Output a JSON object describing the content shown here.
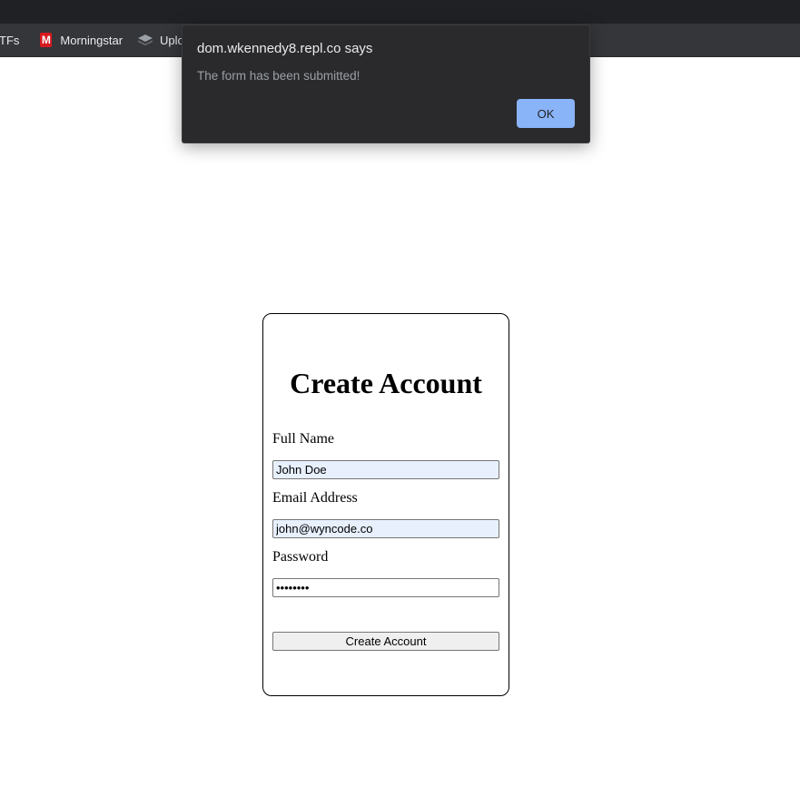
{
  "browser": {
    "bookmarks": [
      {
        "label": "TFs",
        "icon": "none"
      },
      {
        "label": "Morningstar",
        "icon": "morningstar-m-icon"
      },
      {
        "label": "Uploa",
        "icon": "layers-icon"
      }
    ]
  },
  "alert": {
    "title": "dom.wkennedy8.repl.co says",
    "message": "The form has been submitted!",
    "ok_label": "OK",
    "ok_color": "#8ab4f8"
  },
  "form": {
    "title": "Create Account",
    "fields": [
      {
        "label": "Full Name",
        "value": "John Doe",
        "type": "text"
      },
      {
        "label": "Email Address",
        "value": "john@wyncode.co",
        "type": "email"
      },
      {
        "label": "Password",
        "value": "password",
        "type": "password"
      }
    ],
    "submit_label": "Create Account"
  }
}
